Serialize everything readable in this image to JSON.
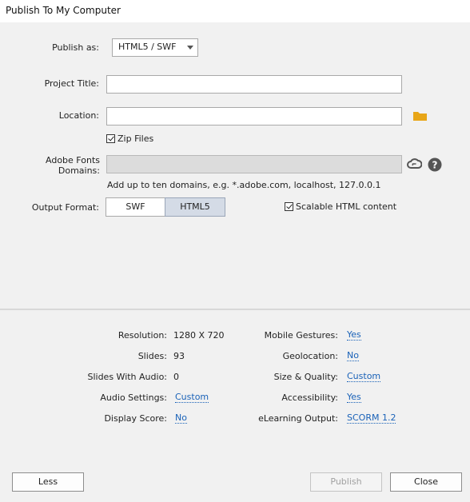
{
  "window": {
    "title": "Publish To My Computer"
  },
  "form": {
    "publish_as_label": "Publish as:",
    "publish_as_value": "HTML5 / SWF",
    "project_title_label": "Project Title:",
    "project_title_value": "",
    "location_label": "Location:",
    "location_value": "",
    "zip_files_label": "Zip Files",
    "zip_files_checked": true,
    "fonts_domains_label": "Adobe Fonts Domains:",
    "fonts_domains_value": "",
    "fonts_domains_hint": "Add up to ten domains, e.g. *.adobe.com, localhost, 127.0.0.1",
    "output_format_label": "Output Format:",
    "output_formats": [
      "SWF",
      "HTML5"
    ],
    "output_format_selected": "HTML5",
    "scalable_label": "Scalable HTML content",
    "scalable_checked": true
  },
  "summary": {
    "resolution_label": "Resolution:",
    "resolution_value": "1280 X 720",
    "slides_label": "Slides:",
    "slides_value": "93",
    "slides_audio_label": "Slides With Audio:",
    "slides_audio_value": "0",
    "audio_settings_label": "Audio Settings:",
    "audio_settings_value": "Custom",
    "display_score_label": "Display Score:",
    "display_score_value": "No",
    "mobile_gestures_label": "Mobile Gestures:",
    "mobile_gestures_value": "Yes",
    "geolocation_label": "Geolocation:",
    "geolocation_value": "No",
    "size_quality_label": "Size & Quality:",
    "size_quality_value": "Custom",
    "accessibility_label": "Accessibility:",
    "accessibility_value": "Yes",
    "elearning_label": "eLearning Output:",
    "elearning_value": "SCORM 1.2"
  },
  "buttons": {
    "less": "Less",
    "publish": "Publish",
    "close": "Close"
  },
  "colors": {
    "link": "#1a62b8",
    "folder": "#e8a618",
    "selected_segment": "#d4dbe6"
  }
}
